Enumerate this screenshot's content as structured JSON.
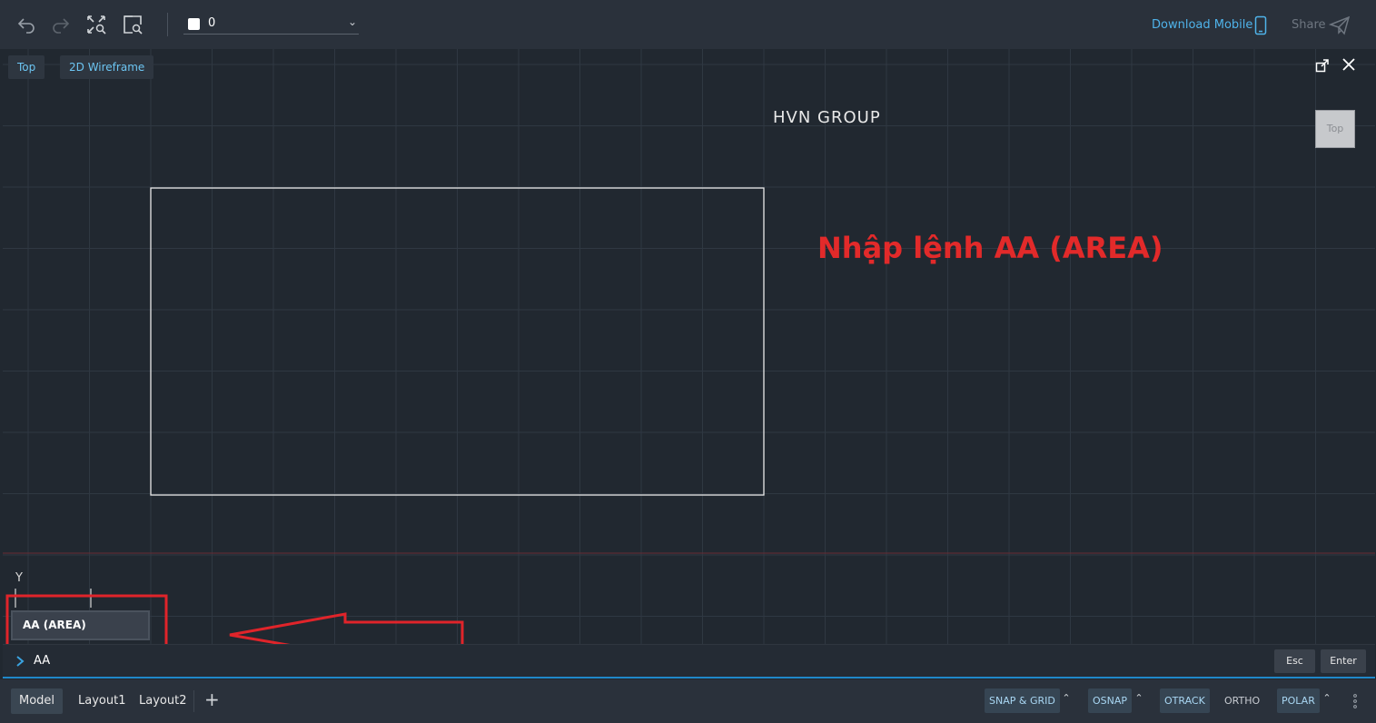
{
  "toolbar": {
    "layer_name": "0",
    "download_mobile": "Download Mobile",
    "share": "Share"
  },
  "viewport": {
    "view_label": "Top",
    "visual_style_label": "2D Wireframe",
    "viewcube_label": "Top"
  },
  "drawing": {
    "text": "HVN  GROUP",
    "annotation": "Nhập lệnh AA (AREA)",
    "ucs_label": "Y"
  },
  "command": {
    "suggestion": "AA (AREA)",
    "input_value": "AA",
    "esc_label": "Esc",
    "enter_label": "Enter"
  },
  "status": {
    "tabs": [
      {
        "label": "Model",
        "active": true
      },
      {
        "label": "Layout1",
        "active": false
      },
      {
        "label": "Layout2",
        "active": false
      }
    ],
    "add_tab": "+",
    "toggles": [
      {
        "label": "SNAP & GRID",
        "on": true
      },
      {
        "label": "OSNAP",
        "on": true
      },
      {
        "label": "OTRACK",
        "on": true
      },
      {
        "label": "ORTHO",
        "on": false
      },
      {
        "label": "POLAR",
        "on": true
      }
    ]
  },
  "colors": {
    "accent": "#4fb3ea",
    "annotation_red": "#e22a2a",
    "canvas_bg": "#212830"
  }
}
